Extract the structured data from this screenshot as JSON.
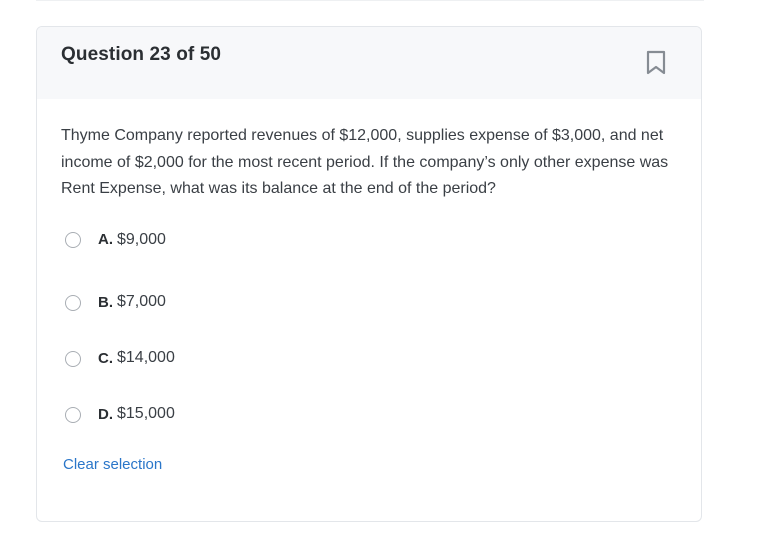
{
  "header": {
    "title": "Question 23 of 50",
    "bookmark_icon": "bookmark-icon"
  },
  "question": {
    "text": "Thyme Company reported revenues of $12,000, supplies expense of $3,000, and net income of $2,000 for the most recent period. If the company’s only other expense was Rent Expense, what was its balance at the end of the period?"
  },
  "options": [
    {
      "letter": "A.",
      "text": "$9,000"
    },
    {
      "letter": "B.",
      "text": "$7,000"
    },
    {
      "letter": "C.",
      "text": "$14,000"
    },
    {
      "letter": "D.",
      "text": "$15,000"
    }
  ],
  "actions": {
    "clear_label": "Clear selection"
  },
  "colors": {
    "accent": "#2a76c9",
    "header_bg": "#f7f8fa",
    "border": "#e3e6ea"
  }
}
